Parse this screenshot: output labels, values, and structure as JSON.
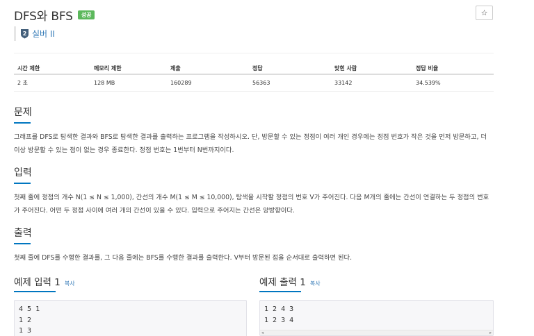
{
  "problem": {
    "title": "DFS와 BFS",
    "badge": "성공",
    "star": "☆",
    "tier_num": "2",
    "tier_label": "실버 II"
  },
  "info": {
    "headers": [
      "시간 제한",
      "메모리 제한",
      "제출",
      "정답",
      "맞힌 사람",
      "정답 비율"
    ],
    "values": [
      "2 초",
      "128 MB",
      "160289",
      "56363",
      "33142",
      "34.539%"
    ]
  },
  "sections": {
    "problem_title": "문제",
    "problem_lines": [
      "그래프를 DFS로 탐색한 결과와 BFS로 탐색한 결과를 출력하는 프로그램을 작성하시오. 단, 방문할 수 있는 정점이 여러 개인 경우에는 정점 번호가 작은 것을 먼저 방문하고, 더",
      "이상 방문할 수 있는 점이 없는 경우 종료한다. 정점 번호는 1번부터 N번까지이다."
    ],
    "input_title": "입력",
    "input_lines": [
      "첫째 줄에 정점의 개수 N(1 ≤ N ≤ 1,000), 간선의 개수 M(1 ≤ M ≤ 10,000), 탐색을 시작할 정점의 번호 V가 주어진다. 다음 M개의 줄에는 간선이 연결하는 두 정점의 번호",
      "가 주어진다. 어떤 두 정점 사이에 여러 개의 간선이 있을 수 있다. 입력으로 주어지는 간선은 양방향이다."
    ],
    "output_title": "출력",
    "output_lines": [
      "첫째 줄에 DFS를 수행한 결과를, 그 다음 줄에는 BFS를 수행한 결과를 출력한다. V부터 방문된 점을 순서대로 출력하면 된다."
    ]
  },
  "samples": {
    "input_title": "예제 입력 1",
    "output_title": "예제 출력 1",
    "copy_label": "복사",
    "input_lines": [
      "4 5 1",
      "1 2",
      "1 3"
    ],
    "output_lines": [
      "1 2 4 3",
      "1 2 3 4"
    ],
    "scroll_left": "◂",
    "scroll_right": "▸"
  }
}
